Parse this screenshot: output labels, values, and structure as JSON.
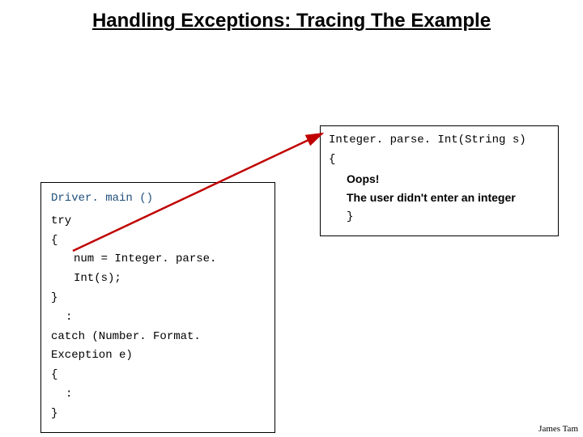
{
  "title": "Handling Exceptions: Tracing The Example",
  "left": {
    "header": "Driver. main ()",
    "l1": "try",
    "l2": "{",
    "l3": "num = Integer. parse. Int(s);",
    "l4": "}",
    "l5": ":",
    "l6": "catch (Number. Format. Exception e)",
    "l7": "{",
    "l8": ":",
    "l9": "}"
  },
  "right": {
    "sig": "Integer. parse. Int(String s)",
    "open": "{",
    "oops": "Oops!",
    "msg": "The user didn't enter an integer",
    "close": "}"
  },
  "footer": "James Tam"
}
